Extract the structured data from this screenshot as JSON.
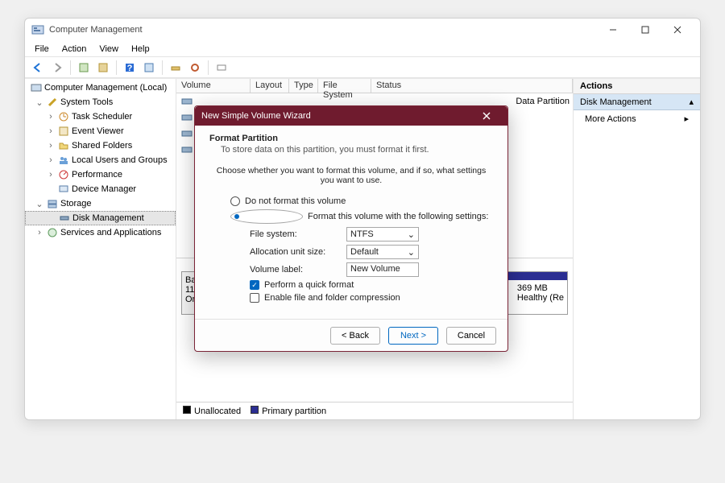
{
  "window": {
    "title": "Computer Management"
  },
  "menu": {
    "file": "File",
    "action": "Action",
    "view": "View",
    "help": "Help"
  },
  "tree": {
    "root": "Computer Management (Local)",
    "systools": "System Tools",
    "task": "Task Scheduler",
    "event": "Event Viewer",
    "shared": "Shared Folders",
    "users": "Local Users and Groups",
    "perf": "Performance",
    "devmgr": "Device Manager",
    "storage": "Storage",
    "diskmgmt": "Disk Management",
    "services": "Services and Applications"
  },
  "listcols": {
    "volume": "Volume",
    "layout": "Layout",
    "type": "Type",
    "fs": "File System",
    "status": "Status"
  },
  "rows_right_partial": "Data Partition",
  "disk_block": {
    "l1": "Ba",
    "l2": "11",
    "l3": "Or"
  },
  "part_right": {
    "size": "369 MB",
    "status": "Healthy (Re"
  },
  "legend": {
    "unalloc": "Unallocated",
    "primary": "Primary partition"
  },
  "actions": {
    "hdr": "Actions",
    "diskmgmt": "Disk Management",
    "more": "More Actions"
  },
  "wizard": {
    "title": "New Simple Volume Wizard",
    "heading": "Format Partition",
    "sub": "To store data on this partition, you must format it first.",
    "instr": "Choose whether you want to format this volume, and if so, what settings you want to use.",
    "r1": "Do not format this volume",
    "r2": "Format this volume with the following settings:",
    "fs_label": "File system:",
    "fs_value": "NTFS",
    "au_label": "Allocation unit size:",
    "au_value": "Default",
    "vl_label": "Volume label:",
    "vl_value": "New Volume",
    "quick": "Perform a quick format",
    "compress": "Enable file and folder compression",
    "back": "< Back",
    "next": "Next >",
    "cancel": "Cancel"
  }
}
